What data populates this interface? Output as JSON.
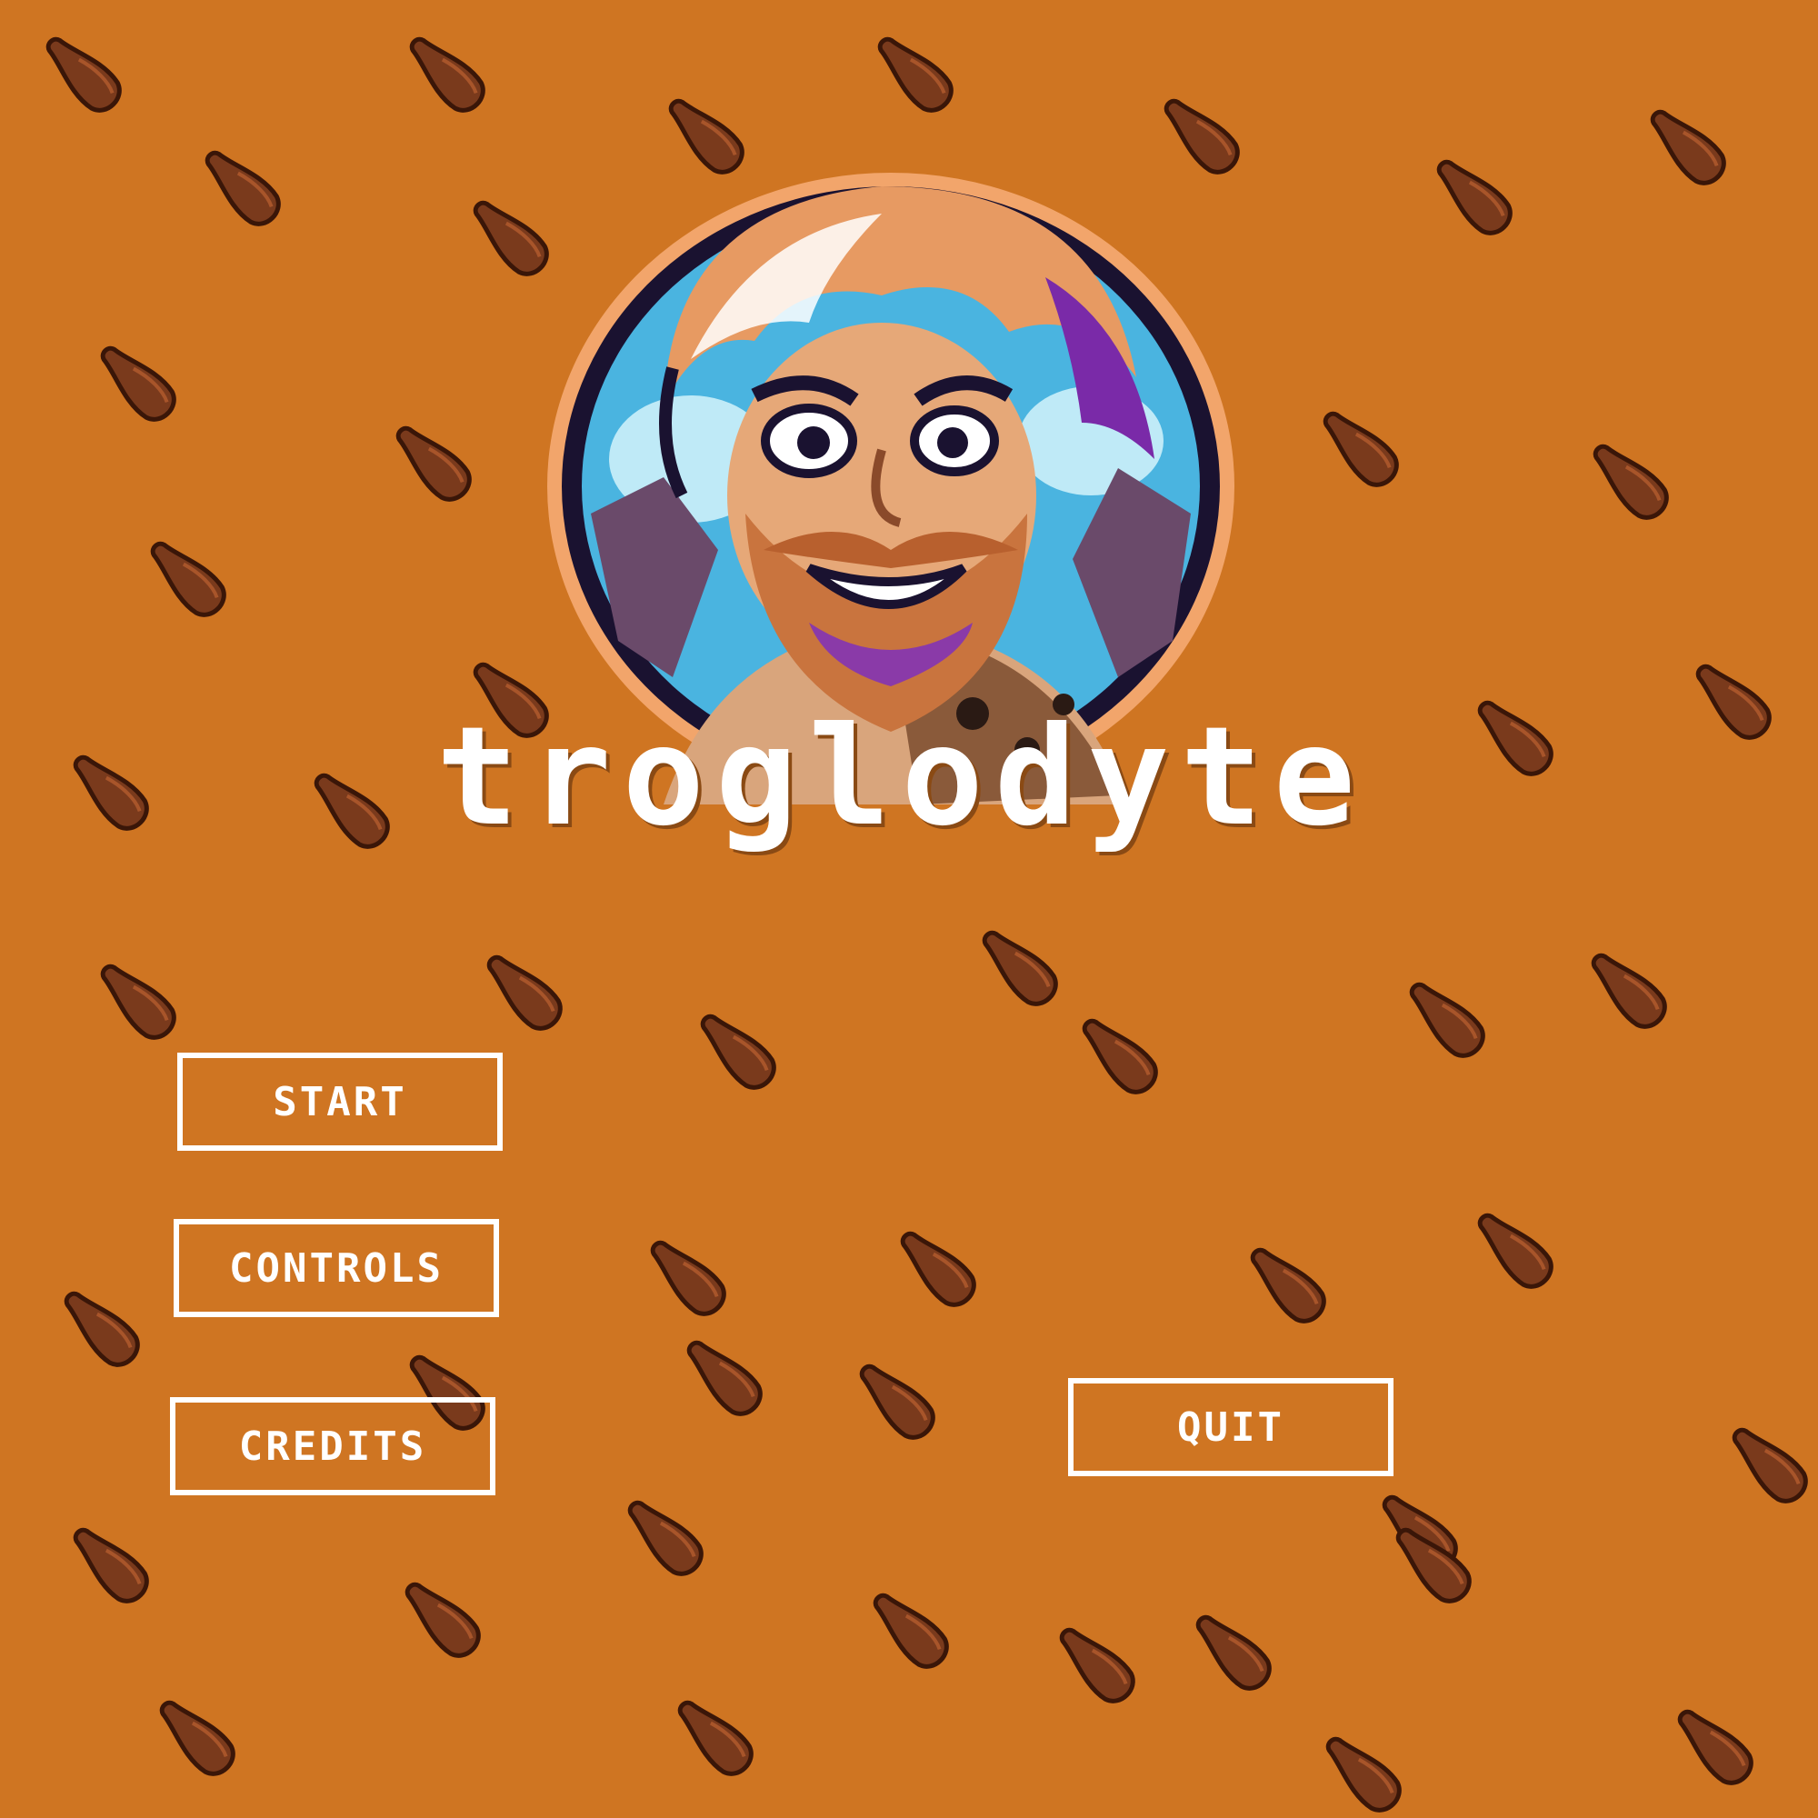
{
  "game": {
    "title": "troglodyte"
  },
  "menu": {
    "start": "START",
    "controls": "CONTROLS",
    "credits": "CREDITS",
    "quit": "QUIT"
  },
  "colors": {
    "background": "#cf7522",
    "club": "#7a3a1c",
    "club_outline": "#3a1608",
    "text": "#ffffff"
  },
  "icons": {
    "background_pattern": "wooden-club-icon",
    "portrait": "caveman-portrait"
  }
}
